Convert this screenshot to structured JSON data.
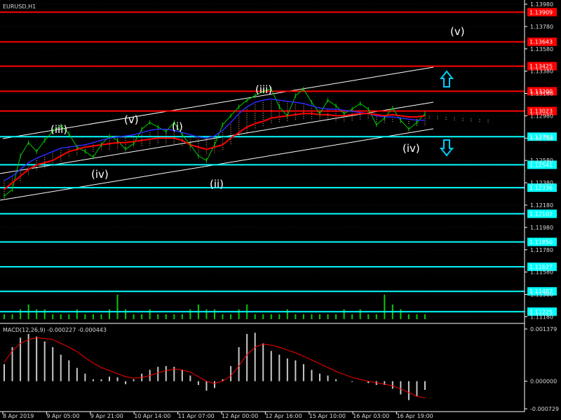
{
  "window": {
    "title": "EURUSD,H1"
  },
  "indicator": {
    "title": "MACD(12,26,9) -0.000227 -0.000443"
  },
  "colors": {
    "background": "#000000",
    "resistance": "#ff0000",
    "support": "#00ffff",
    "price": "#00cc00",
    "ma_slow": "#ff0000",
    "ma_fast": "#2a2aff",
    "cloud": "#ffb08a",
    "histogram": "#c8c8c8",
    "signal": "#ff0000"
  },
  "chart_data": [
    {
      "type": "line",
      "title": "EURUSD,H1",
      "x_ticks": [
        "8 Apr 2019",
        "9 Apr 05:00",
        "9 Apr 21:00",
        "10 Apr 14:00",
        "11 Apr 07:00",
        "12 Apr 00:00",
        "12 Apr 16:00",
        "15 Apr 10:00",
        "16 Apr 03:00",
        "16 Apr 19:00"
      ],
      "y_ticks": [
        "1.13980",
        "1.13780",
        "1.13580",
        "1.13380",
        "1.13180",
        "1.12980",
        "1.12780",
        "1.12580",
        "1.12380",
        "1.12180",
        "1.11980",
        "1.11780",
        "1.11580",
        "1.11380",
        "1.11180"
      ],
      "ylim": [
        1.1112,
        1.1398
      ],
      "resistance_levels": [
        "1.13909",
        "1.13643",
        "1.13425",
        "1.13200",
        "1.13023"
      ],
      "support_levels": [
        "1.12793",
        "1.12541",
        "1.12336",
        "1.12102",
        "1.11850",
        "1.11627",
        "1.11407",
        "1.11225"
      ],
      "wave_labels": [
        "(iii)",
        "(iv)",
        "(v)",
        "(i)",
        "(ii)",
        "(iii)",
        "(iv)",
        "(v)"
      ],
      "projection": {
        "up": "up-arrow-icon",
        "down": "down-arrow-icon"
      },
      "series": [
        {
          "values": [
            1.1226,
            1.1232,
            1.1262,
            1.1274,
            1.1266,
            1.1276,
            1.1284,
            1.1289,
            1.1282,
            1.127,
            1.1266,
            1.1261,
            1.1272,
            1.128,
            1.1276,
            1.1268,
            1.1273,
            1.1286,
            1.1292,
            1.1288,
            1.1284,
            1.1292,
            1.1281,
            1.1272,
            1.1262,
            1.1258,
            1.1272,
            1.129,
            1.1298,
            1.1306,
            1.1312,
            1.1316,
            1.132,
            1.1322,
            1.1306,
            1.1298,
            1.1316,
            1.1322,
            1.131,
            1.13,
            1.1312,
            1.1307,
            1.13,
            1.1304,
            1.1309,
            1.1304,
            1.129,
            1.1296,
            1.1305,
            1.1294,
            1.1286,
            1.1292,
            1.13
          ]
        },
        {
          "values": [
            1.1232,
            1.1238,
            1.1244,
            1.125,
            1.1254,
            1.1256,
            1.1258,
            1.1262,
            1.1266,
            1.1268,
            1.127,
            1.1271,
            1.1272,
            1.1273,
            1.1274,
            1.1274,
            1.1275,
            1.1276,
            1.1277,
            1.1278,
            1.1278,
            1.1278,
            1.1276,
            1.1272,
            1.127,
            1.1268,
            1.127,
            1.1272,
            1.1278,
            1.1283,
            1.1288,
            1.1291,
            1.1293,
            1.1296,
            1.1297,
            1.1298,
            1.1299,
            1.13,
            1.13,
            1.1299,
            1.1299,
            1.1298,
            1.1298,
            1.1299,
            1.13,
            1.13,
            1.1299,
            1.1298,
            1.1299,
            1.1298,
            1.1297,
            1.1297,
            1.1298
          ]
        },
        {
          "values": [
            1.124,
            1.1244,
            1.125,
            1.1256,
            1.126,
            1.1263,
            1.1266,
            1.1269,
            1.127,
            1.1271,
            1.1272,
            1.1274,
            1.1276,
            1.1278,
            1.1279,
            1.128,
            1.1281,
            1.1283,
            1.1285,
            1.1286,
            1.1286,
            1.1285,
            1.1283,
            1.1281,
            1.1279,
            1.1278,
            1.128,
            1.1285,
            1.1292,
            1.13,
            1.1306,
            1.131,
            1.1312,
            1.1313,
            1.1312,
            1.1311,
            1.131,
            1.1309,
            1.1307,
            1.1305,
            1.1304,
            1.1304,
            1.1303,
            1.1302,
            1.1301,
            1.13,
            1.1298,
            1.1297,
            1.1297,
            1.1296,
            1.1295,
            1.1294,
            1.1294
          ]
        }
      ],
      "volume": [
        1,
        1,
        2,
        3,
        2,
        2,
        1,
        1,
        1,
        2,
        1,
        1,
        1,
        2,
        5,
        2,
        1,
        1,
        2,
        1,
        1,
        1,
        1,
        2,
        3,
        2,
        2,
        1,
        1,
        2,
        3,
        1,
        1,
        1,
        1,
        2,
        1,
        1,
        1,
        1,
        1,
        1,
        2,
        1,
        2,
        1,
        1,
        5,
        3,
        2,
        1,
        1,
        1
      ]
    },
    {
      "type": "bar",
      "title": "MACD(12,26,9) -0.000227 -0.000443",
      "y_ticks": [
        "0.001379",
        "0.000000",
        "-0.000729"
      ],
      "ylim": [
        -0.000729,
        0.001379
      ],
      "series": [
        {
          "values": [
            0.00045,
            0.0009,
            0.00115,
            0.00125,
            0.00118,
            0.00105,
            0.0009,
            0.0007,
            0.00055,
            0.00035,
            0.0002,
            5e-05,
            5e-05,
            0.00012,
            0.0001,
            -8e-05,
            5e-05,
            0.0002,
            0.0003,
            0.00038,
            0.0004,
            0.00038,
            0.0003,
            0.00015,
            -0.0001,
            -0.00025,
            -0.00018,
            5e-05,
            0.0004,
            0.0009,
            0.00125,
            0.00128,
            0.001,
            0.0008,
            0.0007,
            0.0006,
            0.00055,
            0.00045,
            0.0003,
            0.0002,
            0.00015,
            5e-05,
            0.0,
            -2e-05,
            0.0,
            -5e-05,
            -0.0001,
            -0.0001,
            -0.0002,
            -0.00035,
            -0.0005,
            -0.0004,
            -0.00023
          ]
        },
        {
          "values": [
            0.0005,
            0.0008,
            0.001,
            0.0011,
            0.00115,
            0.00113,
            0.0011,
            0.001,
            0.0009,
            0.00078,
            0.00062,
            0.00048,
            0.00036,
            0.00028,
            0.0002,
            0.00012,
            8e-05,
            0.0001,
            0.00015,
            0.00022,
            0.00028,
            0.00032,
            0.0003,
            0.00024,
            0.00012,
            0.0,
            -6e-05,
            0.0,
            0.00014,
            0.0004,
            0.0007,
            0.0009,
            0.00098,
            0.00095,
            0.0009,
            0.00082,
            0.00075,
            0.00066,
            0.00056,
            0.00046,
            0.00036,
            0.00026,
            0.00018,
            0.0001,
            5e-05,
            0.0,
            -4e-05,
            -8e-05,
            -0.00012,
            -0.0002,
            -0.0003,
            -0.0004,
            -0.00044
          ]
        }
      ]
    }
  ]
}
